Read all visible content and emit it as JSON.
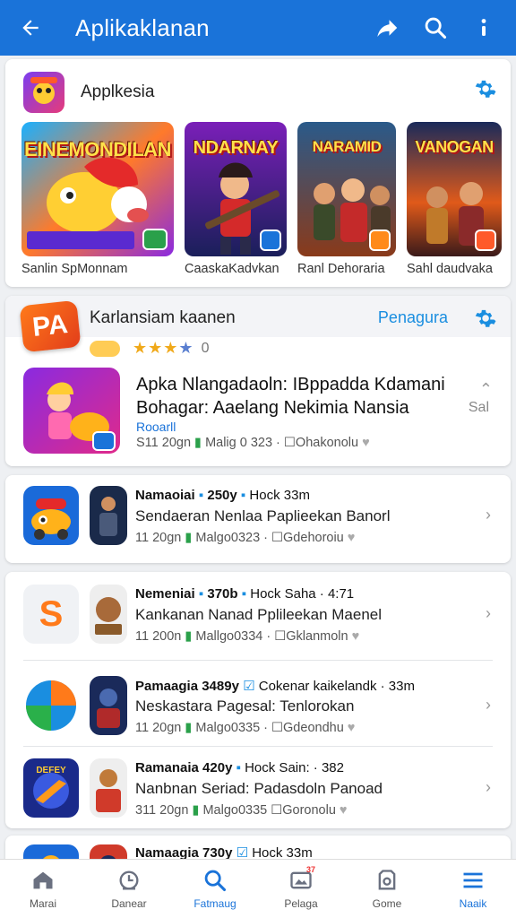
{
  "appbar": {
    "title": "Aplikaklanan"
  },
  "section1": {
    "title": "Applkesia",
    "featured": [
      {
        "art_text": "EINEMONDILAN",
        "caption": "Sanlin SpMonnam"
      },
      {
        "art_text": "NDARNAY",
        "caption": "CaaskaKadvkan"
      },
      {
        "art_text": "NARAMID",
        "caption": "Ranl Dehoraria"
      },
      {
        "art_text": "VANOGAN",
        "caption": "Sahl daudvaka"
      }
    ]
  },
  "section2": {
    "logo_text": "PA",
    "title": "Karlansiam kaanen",
    "link": "Penagura",
    "rating_zero": "0",
    "featured_item": {
      "title": "Apka Nlangadaoln: IBppadda Kdamani Bohagar: Aaelang Nekimia Nansia",
      "link": "Rooarll",
      "side": "Sal",
      "meta_size": "S11 20gn",
      "meta_dev": "Malig 0 323 ·",
      "meta_tag": "Ohakonolu"
    }
  },
  "list": [
    {
      "name": "Namaoiai",
      "ver": "250y",
      "extra": "Hock 33m",
      "desc": "Sendaeran Nenlaa Paplieekan Banorl",
      "size": "11 20gn",
      "dev": "Malgo0323 ·",
      "tag": "Gdehoroiu"
    },
    {
      "name": "Nemeniai",
      "ver": "370b",
      "extra": "Hock Saha · 4:71",
      "desc": "Kankanan Nanad Pplileekan Maenel",
      "size": "11 200n",
      "dev": "Mallgo0334 ·",
      "tag": "Gklanmoln"
    },
    {
      "name": "Pamaagia",
      "ver": "3489y",
      "extra": "Cokenar kaikelandk · 33m",
      "desc": "Neskastara Pagesal: Tenlorokan",
      "size": "11 20gn",
      "dev": "Malgo0335 ·",
      "tag": "Gdeondhu"
    },
    {
      "name": "Ramanaia",
      "ver": "420y",
      "extra": "Hock Sain: · 382",
      "desc": "Nanbnan Seriad: Padasdoln Panoad",
      "size": "311 20gn",
      "dev": "Malgo0335",
      "tag": "Goronolu"
    },
    {
      "name": "Namaagia",
      "ver": "730y",
      "extra": "Hock 33m"
    }
  ],
  "nav": [
    {
      "label": "Marai",
      "icon": "home-icon"
    },
    {
      "label": "Danear",
      "icon": "clock-icon"
    },
    {
      "label": "Fatmaug",
      "icon": "search-icon"
    },
    {
      "label": "Pelaga",
      "icon": "image-icon",
      "badge": "37"
    },
    {
      "label": "Gome",
      "icon": "box-icon"
    },
    {
      "label": "Naaik",
      "icon": "menu-icon"
    }
  ],
  "colors": {
    "primary": "#1a73d9",
    "link": "#1a8ee0",
    "star": "#f0a91a"
  }
}
